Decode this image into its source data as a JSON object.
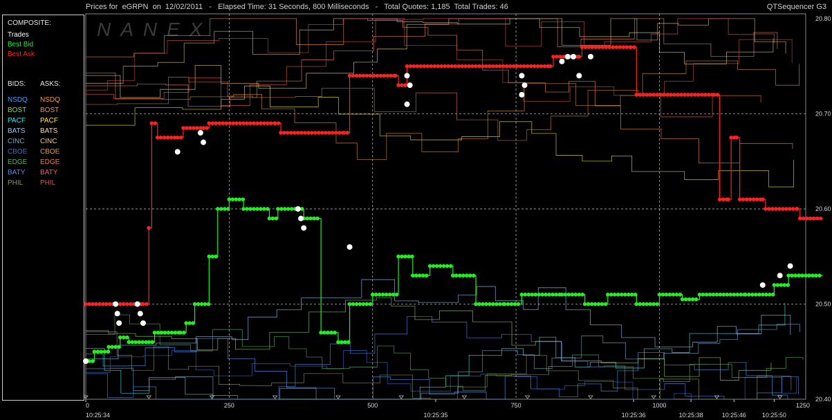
{
  "header": {
    "title": "Prices for  eGRPN  on  12/02/2011   -   Elapsed Time: 31 Seconds, 800 Milliseconds   -   Total Quotes: 1,185  Total Trades: 46",
    "brand": "QTSequencer G3",
    "watermark": "NANEX"
  },
  "legend": {
    "composite_label": "COMPOSITE:",
    "composite": [
      {
        "label": "Trades",
        "color": "#ffffff"
      },
      {
        "label": "Best Bid",
        "color": "#22ee22"
      },
      {
        "label": "Best Ask",
        "color": "#ff2020"
      }
    ],
    "bids_label": "BIDS:",
    "asks_label": "ASKS:",
    "exchanges": [
      {
        "bid": "NSDQ",
        "ask": "NSDQ",
        "bid_color": "#4a9cff",
        "ask_color": "#ff9a4a"
      },
      {
        "bid": "BOST",
        "ask": "BOST",
        "bid_color": "#9ccc6c",
        "ask_color": "#ff8a6a"
      },
      {
        "bid": "PACF",
        "ask": "PACF",
        "bid_color": "#40e8e8",
        "ask_color": "#ffee40"
      },
      {
        "bid": "BATS",
        "ask": "BATS",
        "bid_color": "#9ac8ff",
        "ask_color": "#ffdd88"
      },
      {
        "bid": "CINC",
        "ask": "CINC",
        "bid_color": "#7aa8c8",
        "ask_color": "#e8c898"
      },
      {
        "bid": "CBOE",
        "ask": "CBOE",
        "bid_color": "#3a6ad0",
        "ask_color": "#e89a40"
      },
      {
        "bid": "EDGE",
        "ask": "EDGE",
        "bid_color": "#5cb05c",
        "ask_color": "#e87a4a"
      },
      {
        "bid": "BATY",
        "ask": "BATY",
        "bid_color": "#5a8ae8",
        "ask_color": "#ff5a5a"
      },
      {
        "bid": "PHIL",
        "ask": "PHIL",
        "bid_color": "#8a9a5a",
        "ask_color": "#d05050"
      }
    ]
  },
  "chart_data": {
    "type": "line",
    "title": "Prices for eGRPN on 12/02/2011",
    "xlabel": "",
    "ylabel": "",
    "xlim": [
      0,
      1255
    ],
    "ylim": [
      20.4,
      20.805
    ],
    "grid": true,
    "legend_position": "left",
    "y_ticks": [
      "20.40",
      "20.50",
      "20.60",
      "20.70",
      "20.80"
    ],
    "x_ticks": [
      "0",
      "250",
      "500",
      "750",
      "1000",
      "1250"
    ],
    "time_labels": [
      {
        "x": 0,
        "label": "10:25:34"
      },
      {
        "x": 610,
        "label": "10:25:35"
      },
      {
        "x": 955,
        "label": "10:25:36"
      },
      {
        "x": 1055,
        "label": "10:25:38"
      },
      {
        "x": 1130,
        "label": "10:25:46"
      },
      {
        "x": 1200,
        "label": "10:25:50"
      }
    ],
    "series": [
      {
        "name": "Best Ask",
        "color": "#ff2020",
        "step": [
          [
            0,
            20.5
          ],
          [
            100,
            20.5
          ],
          [
            110,
            20.58
          ],
          [
            115,
            20.69
          ],
          [
            125,
            20.675
          ],
          [
            160,
            20.675
          ],
          [
            170,
            20.685
          ],
          [
            205,
            20.685
          ],
          [
            215,
            20.69
          ],
          [
            330,
            20.69
          ],
          [
            340,
            20.68
          ],
          [
            450,
            20.68
          ],
          [
            460,
            20.74
          ],
          [
            540,
            20.74
          ],
          [
            545,
            20.73
          ],
          [
            560,
            20.75
          ],
          [
            810,
            20.75
          ],
          [
            815,
            20.76
          ],
          [
            860,
            20.76
          ],
          [
            865,
            20.77
          ],
          [
            950,
            20.77
          ],
          [
            960,
            20.72
          ],
          [
            1095,
            20.72
          ],
          [
            1105,
            20.61
          ],
          [
            1120,
            20.61
          ],
          [
            1125,
            20.675
          ],
          [
            1135,
            20.675
          ],
          [
            1140,
            20.61
          ],
          [
            1180,
            20.61
          ],
          [
            1185,
            20.6
          ],
          [
            1240,
            20.6
          ],
          [
            1245,
            20.59
          ],
          [
            1285,
            20.59
          ]
        ]
      },
      {
        "name": "Best Bid",
        "color": "#22ee22",
        "step": [
          [
            0,
            20.44
          ],
          [
            15,
            20.45
          ],
          [
            40,
            20.455
          ],
          [
            60,
            20.465
          ],
          [
            75,
            20.46
          ],
          [
            110,
            20.46
          ],
          [
            120,
            20.47
          ],
          [
            165,
            20.47
          ],
          [
            175,
            20.48
          ],
          [
            190,
            20.5
          ],
          [
            215,
            20.55
          ],
          [
            230,
            20.6
          ],
          [
            250,
            20.61
          ],
          [
            275,
            20.6
          ],
          [
            320,
            20.59
          ],
          [
            335,
            20.6
          ],
          [
            380,
            20.59
          ],
          [
            410,
            20.47
          ],
          [
            440,
            20.46
          ],
          [
            460,
            20.5
          ],
          [
            500,
            20.51
          ],
          [
            545,
            20.55
          ],
          [
            570,
            20.53
          ],
          [
            600,
            20.54
          ],
          [
            640,
            20.53
          ],
          [
            680,
            20.5
          ],
          [
            730,
            20.5
          ],
          [
            760,
            20.51
          ],
          [
            830,
            20.51
          ],
          [
            870,
            20.5
          ],
          [
            910,
            20.51
          ],
          [
            960,
            20.5
          ],
          [
            1000,
            20.51
          ],
          [
            1040,
            20.505
          ],
          [
            1070,
            20.51
          ],
          [
            1150,
            20.51
          ],
          [
            1200,
            20.52
          ],
          [
            1225,
            20.53
          ],
          [
            1285,
            20.53
          ]
        ]
      }
    ],
    "trades": [
      [
        0,
        20.44
      ],
      [
        52,
        20.5
      ],
      [
        55,
        20.49
      ],
      [
        58,
        20.48
      ],
      [
        90,
        20.5
      ],
      [
        95,
        20.49
      ],
      [
        100,
        20.48
      ],
      [
        160,
        20.66
      ],
      [
        200,
        20.68
      ],
      [
        205,
        20.67
      ],
      [
        370,
        20.6
      ],
      [
        375,
        20.59
      ],
      [
        380,
        20.58
      ],
      [
        460,
        20.56
      ],
      [
        560,
        20.74
      ],
      [
        565,
        20.73
      ],
      [
        560,
        20.71
      ],
      [
        760,
        20.74
      ],
      [
        765,
        20.73
      ],
      [
        760,
        20.72
      ],
      [
        830,
        20.755
      ],
      [
        840,
        20.76
      ],
      [
        850,
        20.76
      ],
      [
        860,
        20.74
      ],
      [
        880,
        20.76
      ],
      [
        1180,
        20.52
      ],
      [
        1210,
        20.53
      ],
      [
        1228,
        20.54
      ]
    ]
  }
}
